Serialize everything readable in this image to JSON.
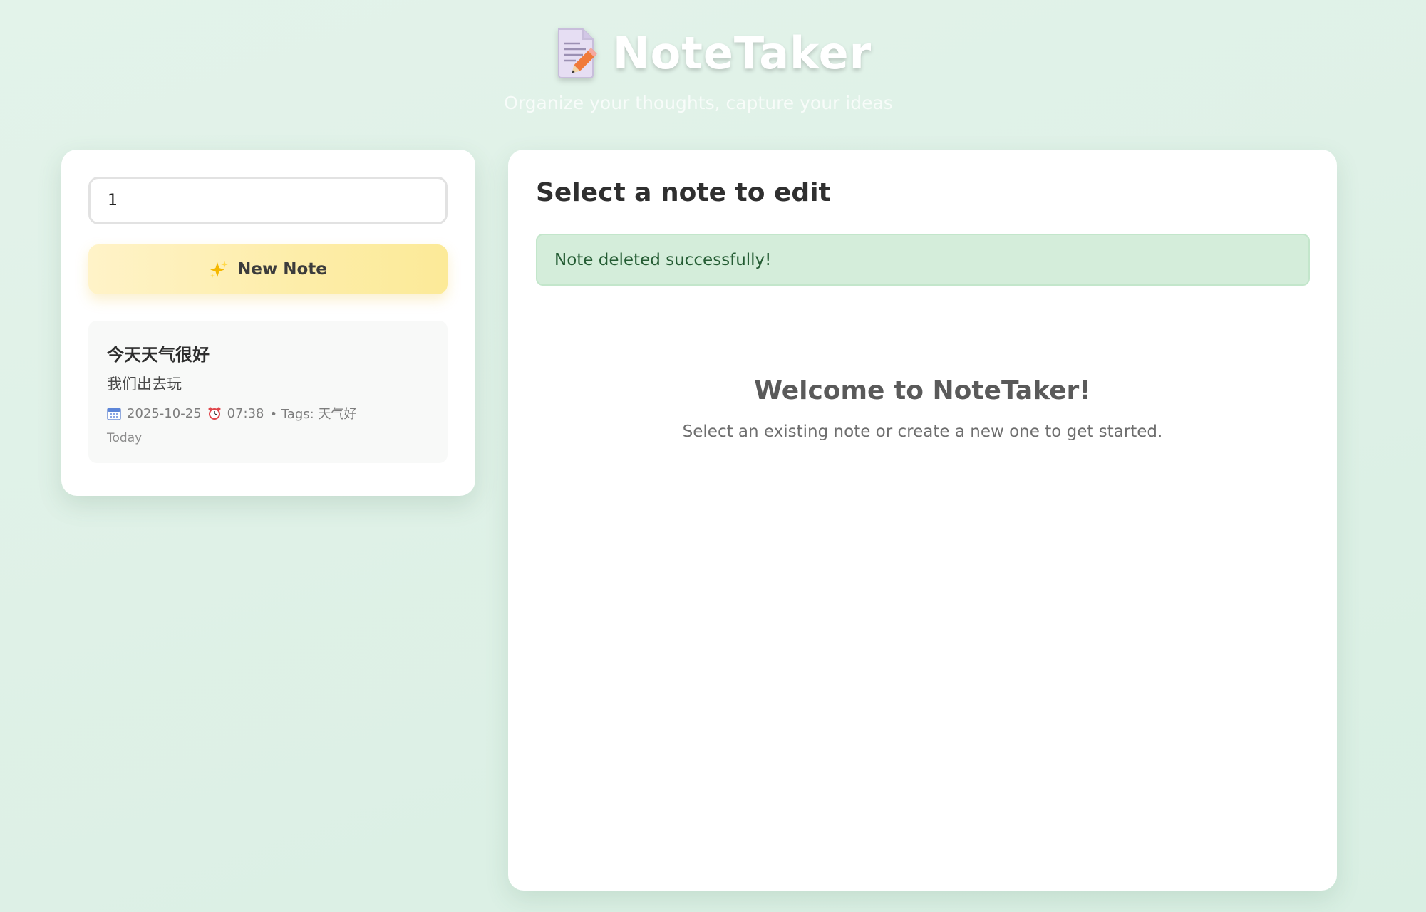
{
  "header": {
    "title": "NoteTaker",
    "subtitle": "Organize your thoughts, capture your ideas",
    "icon": "memo-icon"
  },
  "sidebar": {
    "search": {
      "value": "1",
      "placeholder": ""
    },
    "new_note_button": {
      "icon": "sparkles-icon",
      "label": "New Note"
    },
    "notes": [
      {
        "title": "今天天气很好",
        "preview": "我们出去玩",
        "date_icon": "calendar-icon",
        "date": "2025-10-25",
        "time_icon": "alarm-clock-icon",
        "time": "07:38",
        "tags_text": "• Tags: 天气好",
        "relative": "Today"
      }
    ]
  },
  "main": {
    "heading": "Select a note to edit",
    "alert": {
      "message": "Note deleted successfully!",
      "type": "success"
    },
    "welcome": {
      "title": "Welcome to NoteTaker!",
      "text": "Select an existing note or create a new one to get started."
    }
  },
  "colors": {
    "background": "#dff1e7",
    "alert_bg": "#d4edda",
    "alert_text": "#245c33",
    "button_bg": "#fdeda8"
  }
}
